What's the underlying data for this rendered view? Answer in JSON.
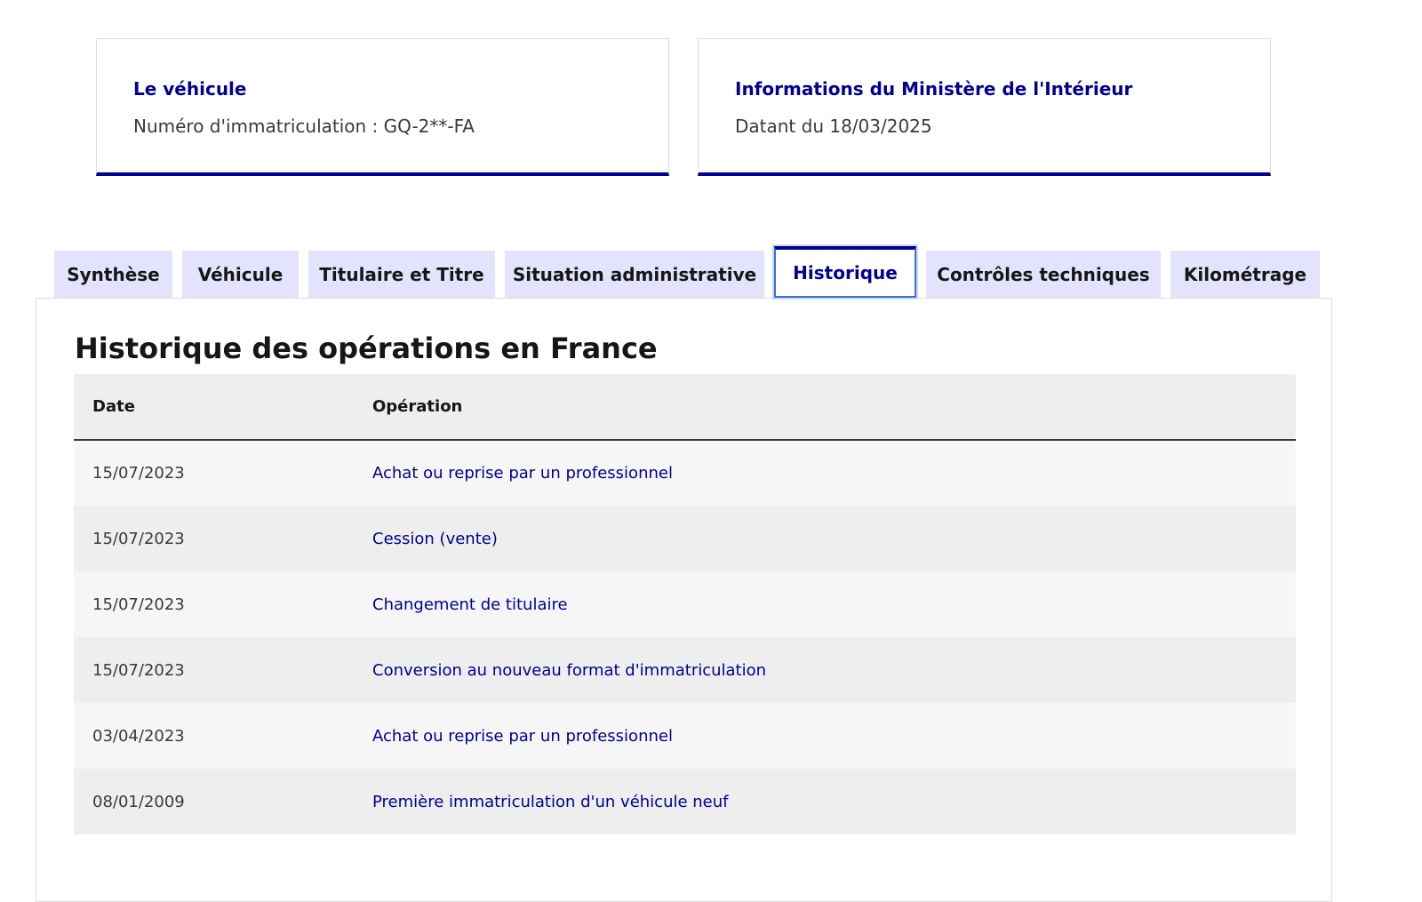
{
  "cards": {
    "vehicle": {
      "title": "Le véhicule",
      "desc": "Numéro d'immatriculation : GQ-2**-FA"
    },
    "ministry": {
      "title": "Informations du Ministère de l'Intérieur",
      "desc": "Datant du 18/03/2025"
    }
  },
  "tabs": [
    {
      "label": "Synthèse"
    },
    {
      "label": "Véhicule"
    },
    {
      "label": "Titulaire et Titre"
    },
    {
      "label": "Situation administrative"
    },
    {
      "label": "Historique"
    },
    {
      "label": "Contrôles techniques"
    },
    {
      "label": "Kilométrage"
    }
  ],
  "active_tab": "Historique",
  "history": {
    "title": "Historique des opérations en France",
    "columns": {
      "date": "Date",
      "operation": "Opération"
    },
    "rows": [
      {
        "date": "15/07/2023",
        "operation": "Achat ou reprise par un professionnel"
      },
      {
        "date": "15/07/2023",
        "operation": "Cession (vente)"
      },
      {
        "date": "15/07/2023",
        "operation": "Changement de titulaire"
      },
      {
        "date": "15/07/2023",
        "operation": "Conversion au nouveau format d'immatriculation"
      },
      {
        "date": "03/04/2023",
        "operation": "Achat ou reprise par un professionnel"
      },
      {
        "date": "08/01/2009",
        "operation": "Première immatriculation d'un véhicule neuf"
      }
    ]
  },
  "colors": {
    "accent": "#000091",
    "tab_bg": "#e3e3fd",
    "row_light": "#f6f6f6",
    "row_dark": "#eeeeee"
  }
}
